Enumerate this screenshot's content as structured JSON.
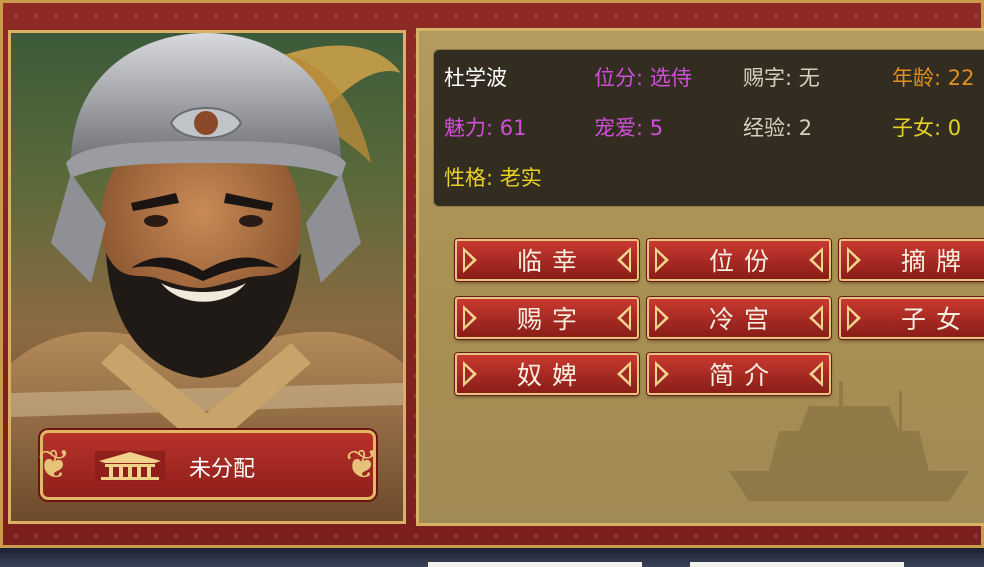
{
  "character": {
    "name": "杜学波",
    "rank": "位分: 选侍",
    "title": "赐字: 无",
    "age": "年龄: 22",
    "charm": "魅力: 61",
    "favor": "宠爱: 5",
    "experience": "经验: 2",
    "children": "子女: 0",
    "personality": "性格: 老实"
  },
  "plaque": {
    "status": "未分配",
    "icon": "palace-icon"
  },
  "actions": [
    "临幸",
    "位份",
    "摘牌",
    "赐字",
    "冷宫",
    "子女",
    "奴婢",
    "简介"
  ],
  "colors": {
    "name": "#ffffff",
    "rank": "#d04ed8",
    "title": "#d6d0c0",
    "age": "#e0901e",
    "charm": "#d04ed8",
    "favor": "#d04ed8",
    "experience": "#d6d0c0",
    "children": "#e8d224",
    "personality": "#e8d224",
    "button": "#a52923",
    "frame": "#7a201d"
  }
}
